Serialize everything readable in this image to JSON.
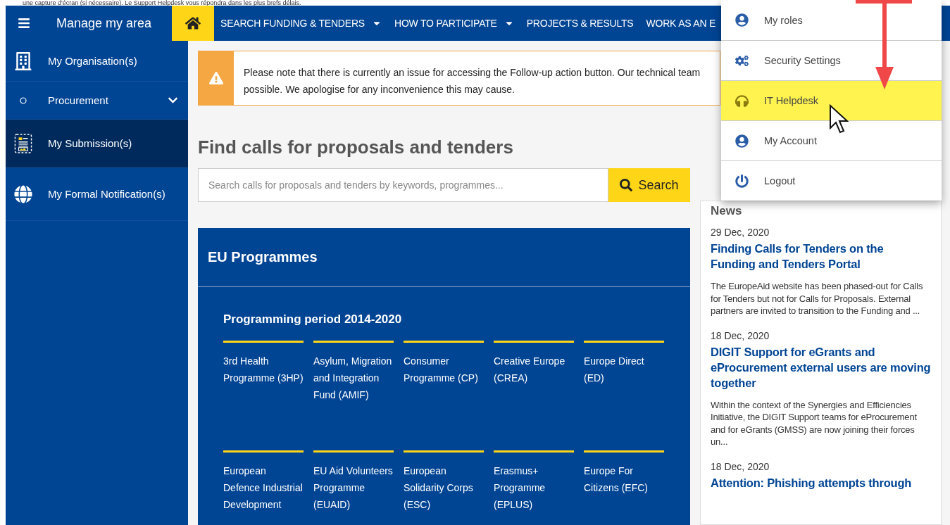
{
  "top_note": "une capture d'écran (si nécessaire). Le Support Helpdesk vous répondra dans les plus brefs délais.",
  "header": {
    "title": "Manage my area",
    "nav": [
      {
        "label": "SEARCH FUNDING & TENDERS",
        "has_menu": true
      },
      {
        "label": "HOW TO PARTICIPATE",
        "has_menu": true
      },
      {
        "label": "PROJECTS & RESULTS",
        "has_menu": false
      },
      {
        "label": "WORK AS AN E",
        "has_menu": false
      }
    ]
  },
  "sidebar": {
    "items": [
      {
        "label": "My Organisation(s)",
        "selected": false
      },
      {
        "label": "Procurement",
        "selected": false,
        "expanded": false
      },
      {
        "label": "My Submission(s)",
        "selected": true
      },
      {
        "label": "My Formal Notification(s)",
        "selected": false
      }
    ]
  },
  "alert": {
    "lines": [
      "Please note that there is currently an issue for accessing the Follow-up action button. Our technical team",
      "possible. We apologise for any inconvenience this may cause."
    ]
  },
  "heading": "Find calls for proposals and tenders",
  "search": {
    "placeholder": "Search calls for proposals and tenders by keywords, programmes...",
    "button": "Search"
  },
  "programmes": {
    "title": "EU Programmes",
    "period": "Programming period 2014-2020",
    "items": [
      "3rd Health Programme (3HP)",
      "Asylum, Migration and Integration Fund (AMIF)",
      "Consumer Programme (CP)",
      "Creative Europe (CREA)",
      "Europe Direct (ED)",
      "European Defence Industrial Development",
      "EU Aid Volunteers Programme (EUAID)",
      "European Solidarity Corps (ESC)",
      "Erasmus+ Programme (EPLUS)",
      "Europe For Citizens (EFC)"
    ]
  },
  "news": {
    "title": "News",
    "items": [
      {
        "date": "29 Dec, 2020",
        "title": "Finding Calls for Tenders on the Funding and Tenders Portal",
        "summary": "The EuropeAid website has been phased-out for Calls for Tenders but not for Calls for Proposals. External partners are invited to transition to the Funding and ..."
      },
      {
        "date": "18 Dec, 2020",
        "title": "DIGIT Support for eGrants and eProcurement external users are moving together",
        "summary": "Within the context of the Synergies and Efficiencies Initiative, the DIGIT Support teams for eProcurement and for eGrants (GMSS) are now joining their forces un..."
      },
      {
        "date": "18 Dec, 2020",
        "title": "Attention: Phishing attempts through"
      }
    ]
  },
  "user_menu": {
    "items": [
      {
        "label": "My roles",
        "selected": false
      },
      {
        "label": "Security Settings",
        "selected": false
      },
      {
        "label": "IT Helpdesk",
        "selected": true
      },
      {
        "label": "My Account",
        "selected": false
      },
      {
        "label": "Logout",
        "selected": false
      }
    ]
  }
}
